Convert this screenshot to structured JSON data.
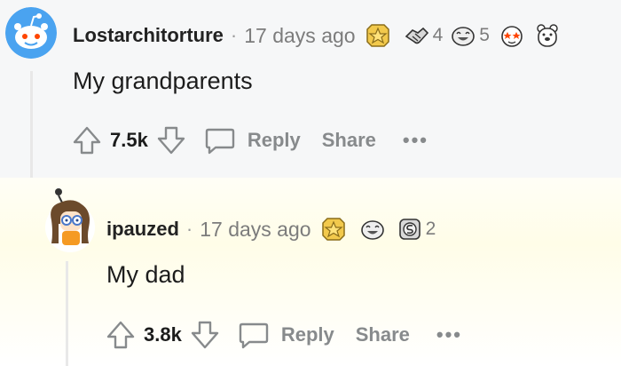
{
  "comments": [
    {
      "username": "Lostarchitorture",
      "time": "17 days ago",
      "awards": [
        {
          "icon": "gold-star-award-icon",
          "count": ""
        },
        {
          "icon": "handshake-award-icon",
          "count": "4"
        },
        {
          "icon": "laughing-face-award-icon",
          "count": "5"
        },
        {
          "icon": "starry-eyed-award-icon",
          "count": ""
        },
        {
          "icon": "bear-award-icon",
          "count": ""
        }
      ],
      "body": "My grandparents",
      "votes": "7.5k",
      "reply_label": "Reply",
      "share_label": "Share",
      "more_label": "•••"
    },
    {
      "username": "ipauzed",
      "time": "17 days ago",
      "awards": [
        {
          "icon": "gold-star-award-icon",
          "count": ""
        },
        {
          "icon": "laughing-face-award-icon",
          "count": ""
        },
        {
          "icon": "silver-award-icon",
          "count": "2"
        }
      ],
      "body": "My dad",
      "votes": "3.8k",
      "reply_label": "Reply",
      "share_label": "Share",
      "more_label": "•••"
    }
  ],
  "colors": {
    "top_background": "#f6f7f8",
    "reply_background": "#fffde8",
    "muted": "#878a8c",
    "award_gold": "#f2c94c"
  }
}
